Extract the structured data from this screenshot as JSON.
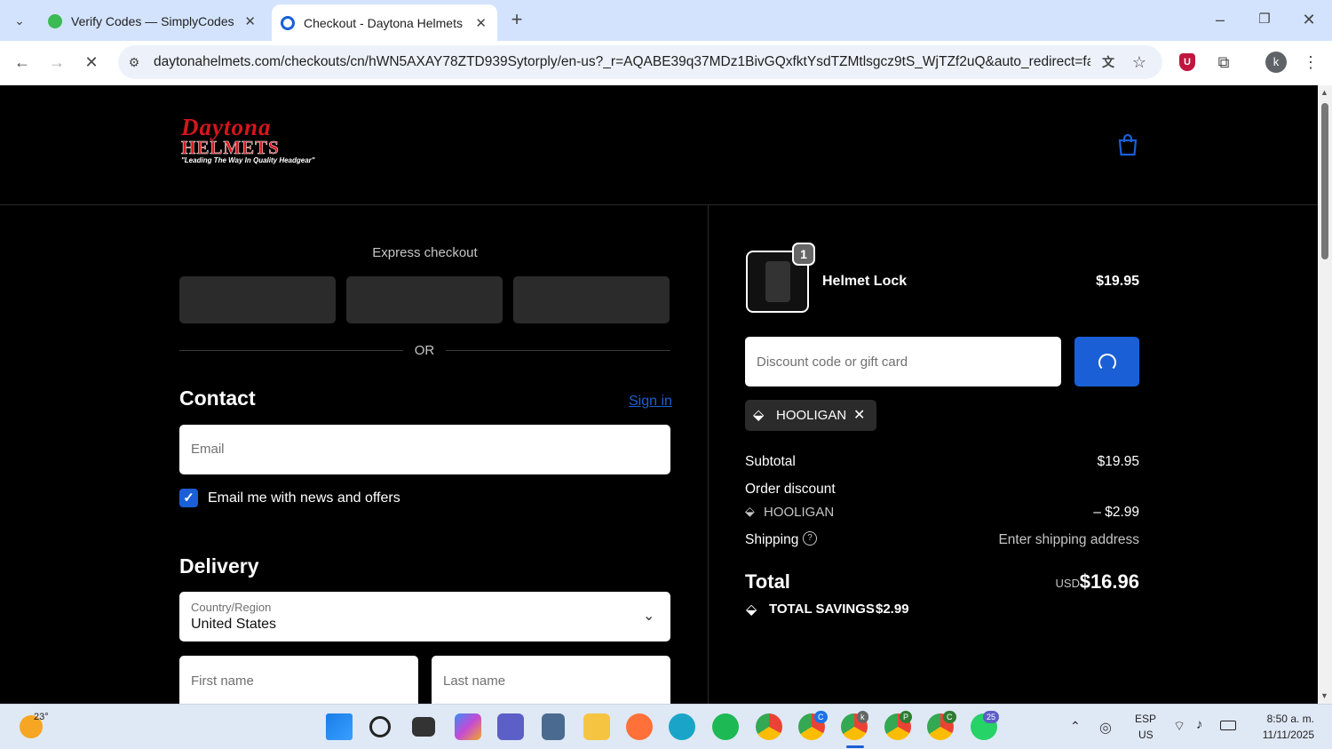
{
  "browser": {
    "tabs": [
      {
        "label": "Verify Codes — SimplyCodes"
      },
      {
        "label": "Checkout - Daytona Helmets"
      }
    ],
    "url": "daytonahelmets.com/checkouts/cn/hWN5AXAY78ZTD939Sytorply/en-us?_r=AQABE39q37MDz1BivGQxfktYsdTZMtlsgcz9tS_WjTZf2uQ&auto_redirect=fals...",
    "profile_initial": "k"
  },
  "logo": {
    "line1": "Daytona",
    "line2": "HELMETS",
    "tagline": "\"Leading The Way In Quality Headgear\""
  },
  "express": {
    "title": "Express checkout",
    "or": "OR"
  },
  "contact": {
    "heading": "Contact",
    "signin": "Sign in",
    "email_placeholder": "Email",
    "newsletter_label": "Email me with news and offers"
  },
  "delivery": {
    "heading": "Delivery",
    "country_label": "Country/Region",
    "country_value": "United States",
    "first_name_placeholder": "First name",
    "last_name_placeholder": "Last name"
  },
  "cart": {
    "quantity": "1",
    "product_name": "Helmet Lock",
    "product_price": "$19.95"
  },
  "discount": {
    "placeholder": "Discount code or gift card",
    "applied_code": "HOOLIGAN"
  },
  "summary": {
    "subtotal_label": "Subtotal",
    "subtotal_value": "$19.95",
    "order_discount_label": "Order discount",
    "discount_code": "HOOLIGAN",
    "discount_value": "– $2.99",
    "shipping_label": "Shipping",
    "shipping_value": "Enter shipping address",
    "total_label": "Total",
    "total_currency": "USD",
    "total_value": "$16.96",
    "savings_label": "TOTAL SAVINGS",
    "savings_value": "$2.99"
  },
  "taskbar": {
    "weather_temp": "23°",
    "lang_line1": "ESP",
    "lang_line2": "US",
    "time": "8:50 a. m.",
    "date": "11/11/2025",
    "whatsapp_badge": "25",
    "chrome_badges": [
      "C",
      "k",
      "P",
      "C"
    ]
  },
  "colors": {
    "accent": "#1a5fd6",
    "brand_red": "#d4161c",
    "tab_strip": "#d3e3fd",
    "page_bg": "#000000"
  }
}
